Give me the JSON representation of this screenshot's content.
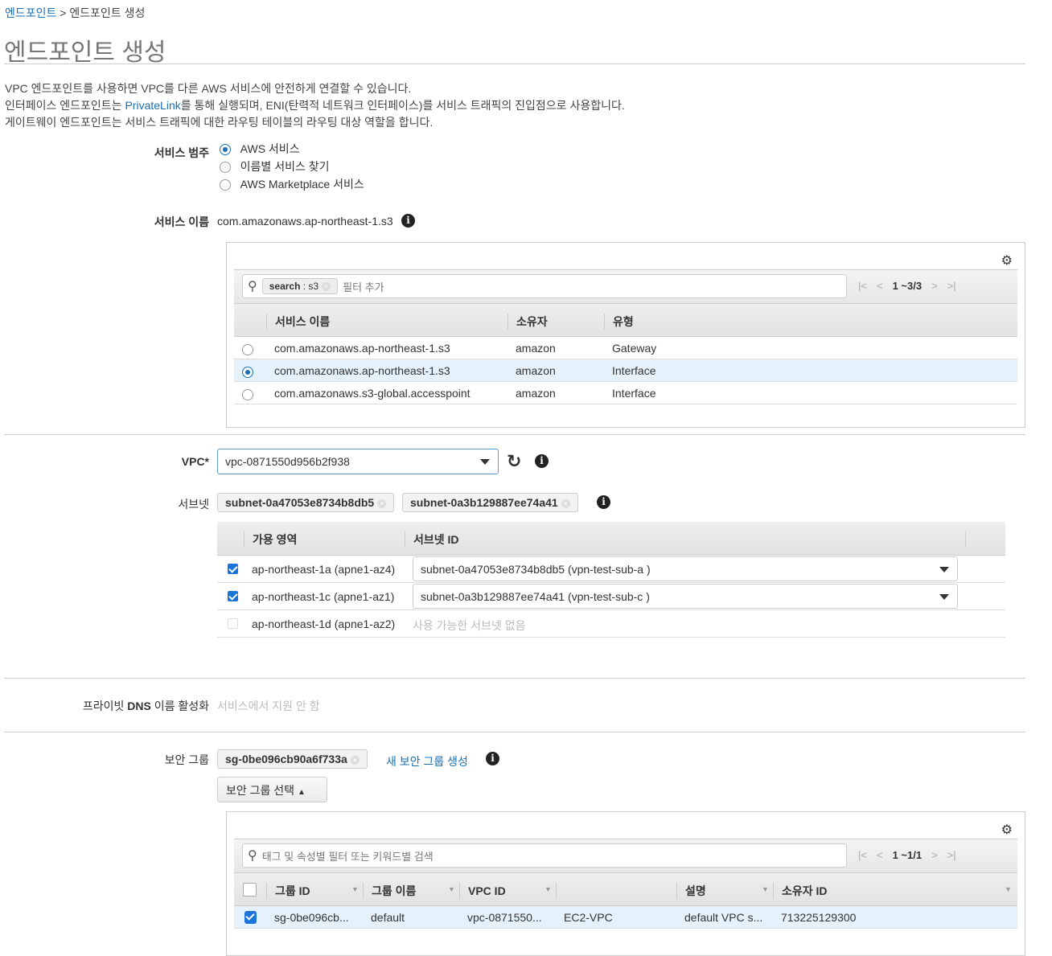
{
  "breadcrumb": {
    "parent": "엔드포인트",
    "sep": ">",
    "current": "엔드포인트 생성"
  },
  "title": "엔드포인트 생성",
  "description": {
    "line1": "VPC 엔드포인트를 사용하면 VPC를 다른 AWS 서비스에 안전하게 연결할 수 있습니다.",
    "line2_pre": "인터페이스 엔드포인트는 ",
    "line2_link": "PrivateLink",
    "line2_post": "를 통해 실행되며, ENI(탄력적 네트워크 인터페이스)를 서비스 트래픽의 진입점으로 사용합니다.",
    "line3": "게이트웨이 엔드포인트는 서비스 트래픽에 대한 라우팅 테이블의 라우팅 대상 역할을 합니다."
  },
  "service_category": {
    "label": "서비스 범주",
    "options": [
      "AWS 서비스",
      "이름별 서비스 찾기",
      "AWS Marketplace 서비스"
    ],
    "selected": 0
  },
  "service_name": {
    "label": "서비스 이름",
    "value": "com.amazonaws.ap-northeast-1.s3"
  },
  "service_table": {
    "filter_chip_key": "search",
    "filter_chip_value": ": s3",
    "filter_placeholder": "필터 추가",
    "pagination": "1 ~3/3",
    "columns": [
      "서비스 이름",
      "소유자",
      "유형"
    ],
    "rows": [
      {
        "name": "com.amazonaws.ap-northeast-1.s3",
        "owner": "amazon",
        "type": "Gateway",
        "selected": false
      },
      {
        "name": "com.amazonaws.ap-northeast-1.s3",
        "owner": "amazon",
        "type": "Interface",
        "selected": true
      },
      {
        "name": "com.amazonaws.s3-global.accesspoint",
        "owner": "amazon",
        "type": "Interface",
        "selected": false
      }
    ]
  },
  "vpc": {
    "label": "VPC*",
    "value": "vpc-0871550d956b2f938"
  },
  "subnets": {
    "label": "서브넷",
    "tags": [
      "subnet-0a47053e8734b8db5",
      "subnet-0a3b129887ee74a41"
    ],
    "columns": [
      "가용 영역",
      "서브넷 ID"
    ],
    "rows": [
      {
        "az": "ap-northeast-1a (apne1-az4)",
        "subnet": "subnet-0a47053e8734b8db5 (vpn-test-sub-a )",
        "checked": true
      },
      {
        "az": "ap-northeast-1c (apne1-az1)",
        "subnet": "subnet-0a3b129887ee74a41 (vpn-test-sub-c )",
        "checked": true
      },
      {
        "az": "ap-northeast-1d (apne1-az2)",
        "subnet": "사용 가능한 서브넷 없음",
        "checked": false
      }
    ]
  },
  "private_dns": {
    "label_pre": "프라이빗 ",
    "label_bold": "DNS",
    "label_post": " 이름 활성화",
    "value": "서비스에서 지원 안 함"
  },
  "security_group": {
    "label": "보안 그룹",
    "tag": "sg-0be096cb90a6f733a",
    "create_link": "새 보안 그룹 생성",
    "select_button": "보안 그룹 선택",
    "search_placeholder": "태그 및 속성별 필터 또는 키워드별 검색",
    "pagination": "1 ~1/1",
    "columns": [
      "그룹 ID",
      "그룹 이름",
      "VPC ID",
      "",
      "설명",
      "소유자 ID"
    ],
    "rows": [
      {
        "id": "sg-0be096cb...",
        "name": "default",
        "vpc": "vpc-0871550...",
        "platform": "EC2-VPC",
        "desc": "default VPC s...",
        "owner": "713225129300",
        "checked": true
      }
    ]
  }
}
